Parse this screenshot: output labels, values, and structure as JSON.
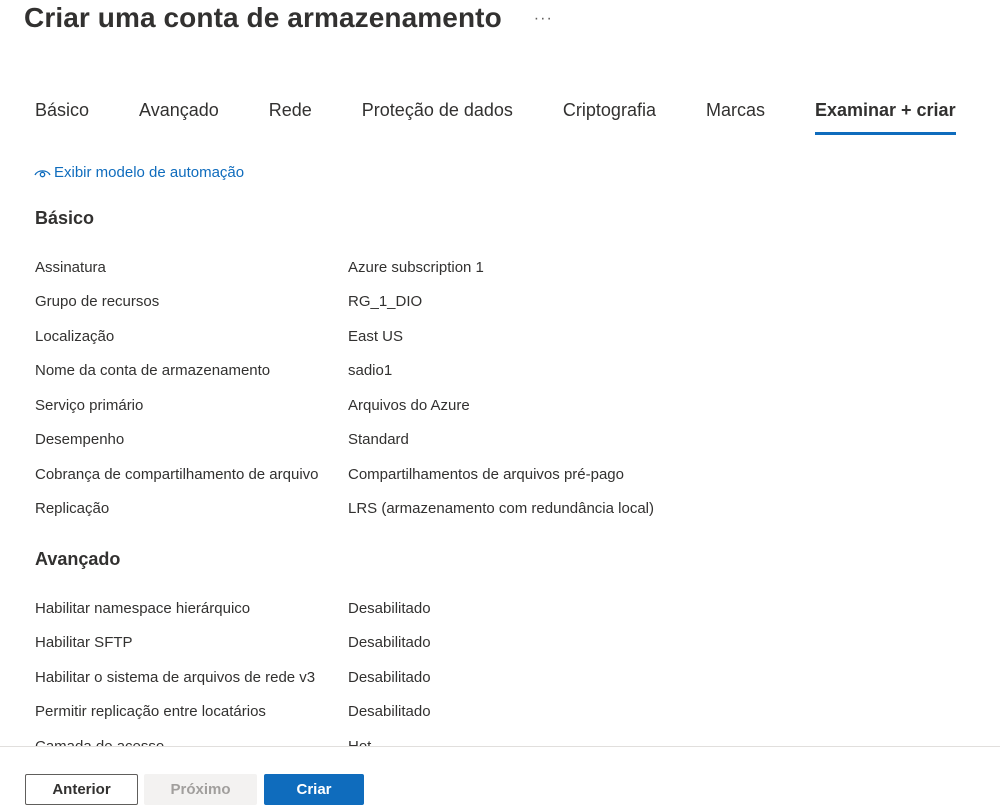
{
  "header": {
    "title": "Criar uma conta de armazenamento",
    "more": "···"
  },
  "tabs": [
    {
      "label": "Básico",
      "active": false
    },
    {
      "label": "Avançado",
      "active": false
    },
    {
      "label": "Rede",
      "active": false
    },
    {
      "label": "Proteção de dados",
      "active": false
    },
    {
      "label": "Criptografia",
      "active": false
    },
    {
      "label": "Marcas",
      "active": false
    },
    {
      "label": "Examinar + criar",
      "active": true
    }
  ],
  "automation_link": {
    "label": "Exibir modelo de automação",
    "icon": "eye-icon"
  },
  "sections": {
    "basic": {
      "title": "Básico",
      "rows": [
        {
          "label": "Assinatura",
          "value": "Azure subscription 1"
        },
        {
          "label": "Grupo de recursos",
          "value": "RG_1_DIO"
        },
        {
          "label": "Localização",
          "value": "East US"
        },
        {
          "label": "Nome da conta de armazenamento",
          "value": "sadio1"
        },
        {
          "label": "Serviço primário",
          "value": "Arquivos do Azure"
        },
        {
          "label": "Desempenho",
          "value": "Standard"
        },
        {
          "label": "Cobrança de compartilhamento de arquivo",
          "value": "Compartilhamentos de arquivos pré-pago"
        },
        {
          "label": "Replicação",
          "value": "LRS (armazenamento com redundância local)"
        }
      ]
    },
    "advanced": {
      "title": "Avançado",
      "rows": [
        {
          "label": "Habilitar namespace hierárquico",
          "value": "Desabilitado"
        },
        {
          "label": "Habilitar SFTP",
          "value": "Desabilitado"
        },
        {
          "label": "Habilitar o sistema de arquivos de rede v3",
          "value": "Desabilitado"
        },
        {
          "label": "Permitir replicação entre locatários",
          "value": "Desabilitado"
        },
        {
          "label": "Camada de acesso",
          "value": "Hot"
        }
      ]
    }
  },
  "footer": {
    "prev_label": "Anterior",
    "next_label": "Próximo",
    "create_label": "Criar"
  },
  "colors": {
    "accent": "#0f6cbd",
    "text": "#323130",
    "disabled_bg": "#f3f2f1",
    "disabled_text": "#a19f9d"
  }
}
